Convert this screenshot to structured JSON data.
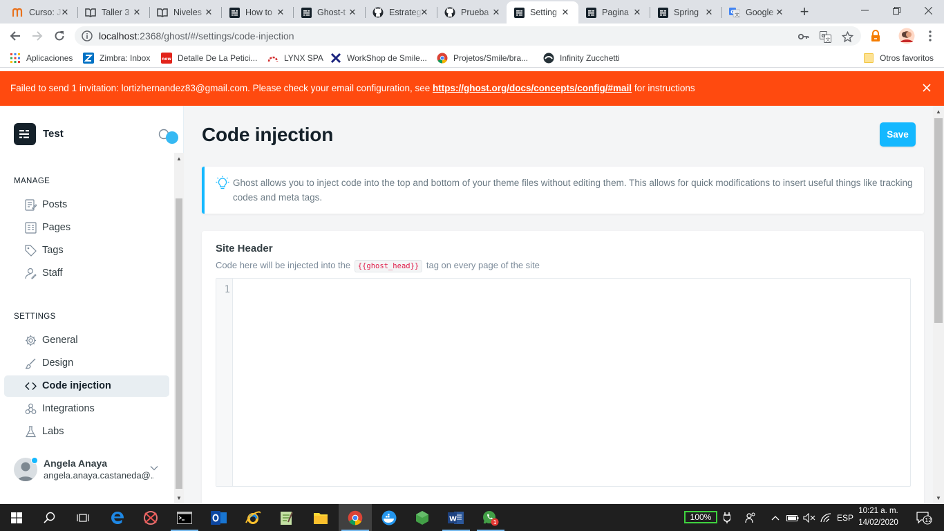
{
  "browser": {
    "tabs": [
      {
        "title": "Curso: J",
        "icon": "coursera-icon"
      },
      {
        "title": "Taller 3",
        "icon": "book-icon"
      },
      {
        "title": "Niveles",
        "icon": "book-icon"
      },
      {
        "title": "How to",
        "icon": "ghost-icon"
      },
      {
        "title": "Ghost-t",
        "icon": "ghost-icon"
      },
      {
        "title": "Estrateg",
        "icon": "github-icon"
      },
      {
        "title": "Prueba",
        "icon": "github-icon"
      },
      {
        "title": "Setting",
        "icon": "ghost-icon",
        "active": true
      },
      {
        "title": "Pagina",
        "icon": "ghost-icon"
      },
      {
        "title": "Spring",
        "icon": "ghost-icon"
      },
      {
        "title": "Google",
        "icon": "google-translate-icon"
      }
    ],
    "url_host": "localhost",
    "url_path": ":2368/ghost/#/settings/code-injection",
    "bookmarks": [
      {
        "label": "Aplicaciones"
      },
      {
        "label": "Zimbra: Inbox"
      },
      {
        "label": "Detalle De La Petici..."
      },
      {
        "label": "LYNX SPA"
      },
      {
        "label": "WorkShop de Smile..."
      },
      {
        "label": "Projetos/Smile/bra..."
      },
      {
        "label": "Infinity Zucchetti"
      }
    ],
    "other_bookmarks": "Otros favoritos"
  },
  "alert": {
    "message": "Failed to send 1 invitation: lortizhernandez83@gmail.com. Please check your email configuration, see ",
    "link": "https://ghost.org/docs/concepts/config/#mail",
    "suffix": " for instructions"
  },
  "sidebar": {
    "site_title": "Test",
    "manage_heading": "MANAGE",
    "manage_items": [
      {
        "label": "Posts",
        "icon": "posts-icon"
      },
      {
        "label": "Pages",
        "icon": "pages-icon"
      },
      {
        "label": "Tags",
        "icon": "tag-icon"
      },
      {
        "label": "Staff",
        "icon": "staff-icon"
      }
    ],
    "settings_heading": "SETTINGS",
    "settings_items": [
      {
        "label": "General",
        "icon": "gear-icon"
      },
      {
        "label": "Design",
        "icon": "brush-icon"
      },
      {
        "label": "Code injection",
        "icon": "code-icon",
        "active": true
      },
      {
        "label": "Integrations",
        "icon": "integrations-icon"
      },
      {
        "label": "Labs",
        "icon": "flask-icon"
      }
    ],
    "user": {
      "name": "Angela Anaya",
      "email": "angela.anaya.castaneda@..."
    }
  },
  "main": {
    "title": "Code injection",
    "save_label": "Save",
    "hint": "Ghost allows you to inject code into the top and bottom of your theme files without editing them. This allows for quick modifications to insert useful things like tracking codes and meta tags.",
    "section": {
      "heading": "Site Header",
      "desc_before": "Code here will be injected into the ",
      "desc_code": "{{ghost_head}}",
      "desc_after": " tag on every page of the site",
      "line_number": "1"
    }
  },
  "taskbar": {
    "battery": "100%",
    "language": "ESP",
    "time": "10:21 a. m.",
    "date": "14/02/2020",
    "notifications": "12",
    "whatsapp_badge": "1"
  },
  "colors": {
    "accent": "#14b8ff",
    "alert": "#ff4a0f",
    "ghost_dark": "#15212a"
  }
}
